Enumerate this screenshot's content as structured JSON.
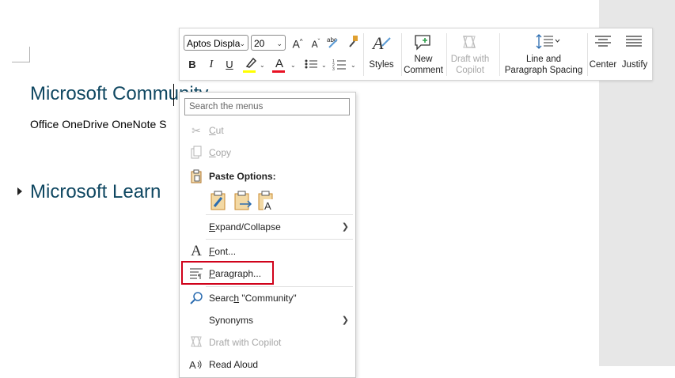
{
  "document": {
    "heading1": "Microsoft Community",
    "body_line": "Office OneDrive OneNote S",
    "heading2": "Microsoft Learn"
  },
  "mini_toolbar": {
    "font_name": "Aptos Displa",
    "font_size": "20",
    "grow_font_icon": "A^",
    "shrink_font_icon": "A˅",
    "clear_format_text": "abc",
    "bold": "B",
    "italic": "I",
    "underline": "U",
    "font_color_icon": "A",
    "styles_label": "Styles",
    "new_comment_label_1": "New",
    "new_comment_label_2": "Comment",
    "draft_copilot_label_1": "Draft with",
    "draft_copilot_label_2": "Copilot",
    "line_spacing_label_1": "Line and",
    "line_spacing_label_2": "Paragraph Spacing",
    "center_label": "Center",
    "justify_label": "Justify",
    "colors": {
      "highlight": "#ffff00",
      "font_color": "#e81123"
    }
  },
  "context_menu": {
    "search_placeholder": "Search the menus",
    "cut_before": "",
    "cut_u": "C",
    "cut_after": "ut",
    "copy_before": "",
    "copy_u": "C",
    "copy_after": "opy",
    "paste_options_label": "Paste Options:",
    "expand_u": "E",
    "expand_after": "xpand/Collapse",
    "font_u": "F",
    "font_after": "ont...",
    "paragraph_u": "P",
    "paragraph_after": "aragraph...",
    "search_before": "Searc",
    "search_u": "h",
    "search_after": " \"Community\"",
    "synonyms_label": "Synonyms",
    "draft_copilot_label": "Draft with Copilot",
    "read_aloud_label": "Read Aloud"
  },
  "icons": {
    "cut": "scissors-icon",
    "copy": "copy-icon",
    "paste": "clipboard-icon",
    "font": "font-icon",
    "paragraph": "paragraph-icon",
    "search": "search-icon",
    "copilot": "copilot-icon",
    "read_aloud": "read-aloud-icon"
  },
  "accent_highlight_color": "#d0021b"
}
